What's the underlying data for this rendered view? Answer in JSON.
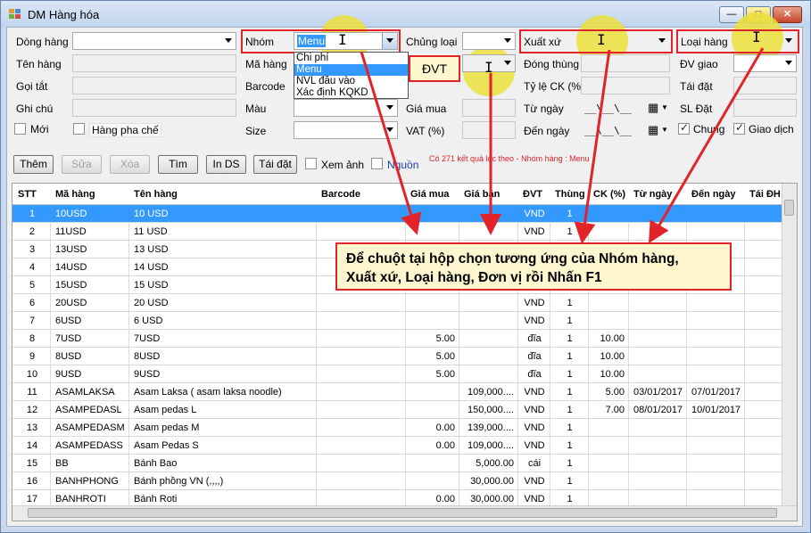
{
  "window": {
    "title": "DM Hàng hóa",
    "min": "—",
    "max": "□",
    "close": "✕"
  },
  "form": {
    "dong_hang": "Dòng hàng",
    "ten_hang": "Tên hàng",
    "goi_tat": "Gọi tắt",
    "ghi_chu": "Ghi chú",
    "moi": "Mới",
    "hang_pha_che": "Hàng pha chế",
    "nhom": "Nhóm",
    "nhom_value": "Menu",
    "ma_hang": "Mã hàng",
    "barcode": "Barcode",
    "mau": "Màu",
    "size": "Size",
    "chung_loai": "Chủng loại",
    "gia_mua": "Giá mua",
    "vat": "VAT (%)",
    "xuat_xu": "Xuất xứ",
    "dong_thung": "Đóng thùng",
    "ty_le_ck": "Tỷ lệ CK (%)",
    "tu_ngay": "Từ ngày",
    "den_ngay": "Đến ngày",
    "date_placeholder": "__\\__\\__",
    "loai_hang": "Loại hàng",
    "dv_giao": "ĐV giao",
    "tai_dat": "Tái đặt",
    "sl_dat": "SL Đặt",
    "chung": "Chung",
    "giao_dich": "Giao dịch"
  },
  "dropdown": {
    "items": [
      "Chi phí",
      "Menu",
      "NVL đầu vào",
      "Xác định KQKD"
    ],
    "selected_index": 1
  },
  "dvt_label": "ĐVT",
  "toolbar": {
    "them": "Thêm",
    "sua": "Sửa",
    "xoa": "Xóa",
    "tim": "Tìm",
    "in_ds": "In DS",
    "tai_dat": "Tái đặt",
    "xem_anh": "Xem ảnh",
    "nguon": "Nguồn",
    "status": "Có 271 kết quả lọc theo  - Nhóm hàng : Menu"
  },
  "grid": {
    "columns": [
      "STT",
      "Mã hàng",
      "Tên hàng",
      "Barcode",
      "Giá mua",
      "Giá bán",
      "ĐVT",
      "Thùng",
      "CK (%)",
      "Từ ngày",
      "Đến ngày",
      "Tái ĐH"
    ],
    "rows": [
      [
        "1",
        "10USD",
        "10 USD",
        "",
        "",
        "",
        "VND",
        "1",
        "",
        "",
        "",
        ""
      ],
      [
        "2",
        "11USD",
        "11 USD",
        "",
        "",
        "",
        "VND",
        "1",
        "",
        "",
        "",
        ""
      ],
      [
        "3",
        "13USD",
        "13 USD",
        "",
        "",
        "",
        "",
        "",
        "",
        "",
        "",
        ""
      ],
      [
        "4",
        "14USD",
        "14 USD",
        "",
        "",
        "",
        "",
        "",
        "",
        "",
        "",
        ""
      ],
      [
        "5",
        "15USD",
        "15 USD",
        "",
        "",
        "",
        "",
        "",
        "",
        "",
        "",
        ""
      ],
      [
        "6",
        "20USD",
        "20 USD",
        "",
        "",
        "",
        "VND",
        "1",
        "",
        "",
        "",
        ""
      ],
      [
        "7",
        "6USD",
        "6 USD",
        "",
        "",
        "",
        "VND",
        "1",
        "",
        "",
        "",
        ""
      ],
      [
        "8",
        "7USD",
        "7USD",
        "",
        "5.00",
        "",
        "đĩa",
        "1",
        "10.00",
        "",
        "",
        ""
      ],
      [
        "9",
        "8USD",
        "8USD",
        "",
        "5.00",
        "",
        "đĩa",
        "1",
        "10.00",
        "",
        "",
        ""
      ],
      [
        "10",
        "9USD",
        "9USD",
        "",
        "5.00",
        "",
        "đĩa",
        "1",
        "10.00",
        "",
        "",
        ""
      ],
      [
        "11",
        "ASAMLAKSA",
        "Asam Laksa ( asam laksa noodle)",
        "",
        "",
        "109,000....",
        "VND",
        "1",
        "5.00",
        "03/01/2017",
        "07/01/2017",
        ""
      ],
      [
        "12",
        "ASAMPEDASL",
        "Asam pedas L",
        "",
        "",
        "150,000....",
        "VND",
        "1",
        "7.00",
        "08/01/2017",
        "10/01/2017",
        ""
      ],
      [
        "13",
        "ASAMPEDASM",
        "Asam pedas M",
        "",
        "0.00",
        "139,000....",
        "VND",
        "1",
        "",
        "",
        "",
        ""
      ],
      [
        "14",
        "ASAMPEDASS",
        "Asam Pedas S",
        "",
        "0.00",
        "109,000....",
        "VND",
        "1",
        "",
        "",
        "",
        ""
      ],
      [
        "15",
        "BB",
        "Bánh Bao",
        "",
        "",
        "5,000.00",
        "cái",
        "1",
        "",
        "",
        "",
        ""
      ],
      [
        "16",
        "BANHPHONG",
        "Bánh phồng VN (,,,,)",
        "",
        "",
        "30,000.00",
        "VND",
        "1",
        "",
        "",
        "",
        ""
      ],
      [
        "17",
        "BANHROTI",
        "Bánh Roti",
        "",
        "0.00",
        "30,000.00",
        "VND",
        "1",
        "",
        "",
        "",
        ""
      ]
    ]
  },
  "callout": {
    "line1": "Để chuột tại hộp chọn tương ứng của Nhóm hàng,",
    "line2": "Xuất xứ, Loại hàng, Đơn vị rồi Nhấn F1"
  },
  "colors": {
    "red": "#e0242a",
    "selection": "#3399ff",
    "highlight": "#ebe13c",
    "note_bg": "#fdf6cf",
    "status_text": "#e0242a"
  }
}
